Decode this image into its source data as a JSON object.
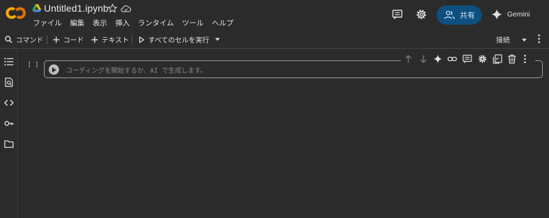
{
  "header": {
    "logo": "CO",
    "title": "Untitled1.ipynb",
    "menus": [
      "ファイル",
      "編集",
      "表示",
      "挿入",
      "ランタイム",
      "ツール",
      "ヘルプ"
    ],
    "share_label": "共有",
    "gemini_label": "Gemini"
  },
  "toolbar": {
    "command_label": "コマンド",
    "add_code_label": "コード",
    "add_text_label": "テキスト",
    "run_all_label": "すべてのセルを実行",
    "connect_label": "接続"
  },
  "cell": {
    "bracket": "[ ]",
    "placeholder": "コーディングを開始するか、AI で生成します。"
  },
  "colors": {
    "background": "#2b2b2b",
    "logo_orange": "#f9ab00",
    "share_button": "#0d4f7e",
    "cell_border": "#9aa0a6"
  },
  "icons": {
    "header": [
      "drive-icon",
      "star-icon",
      "cloud-icon",
      "comment-icon",
      "settings-icon",
      "share-people-icon",
      "gemini-sparkle-icon"
    ],
    "sidebar": [
      "table-of-contents-icon",
      "find-replace-icon",
      "code-snippets-icon",
      "secrets-key-icon",
      "files-folder-icon"
    ],
    "cell_toolbar": [
      "move-up-icon",
      "move-down-icon",
      "gemini-sparkle-icon",
      "link-icon",
      "comment-icon",
      "settings-icon",
      "mirror-cell-icon",
      "delete-icon",
      "more-vert-icon"
    ]
  }
}
